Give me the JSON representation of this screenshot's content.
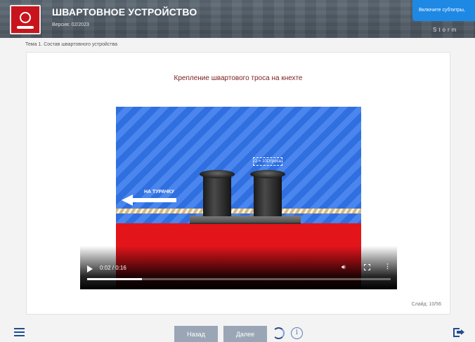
{
  "header": {
    "title": "ШВАРТОВНОЕ УСТРОЙСТВО",
    "version": "Версия: 02/2023",
    "subtitles_button": "Включите субтитры,",
    "brand": "Storm"
  },
  "topic": "Тема 1. Состав швартовного устройства",
  "slide": {
    "heading": "Крепление швартового троса на кнехте",
    "counter": "Слайд: 10/56"
  },
  "video": {
    "arrow_label": "НА ТУРАЧКУ",
    "dimension_label": "D = 10Dтроса",
    "time": "0:02 / 0:16",
    "progress": 0.18
  },
  "nav": {
    "back_label": "Назад",
    "next_label": "Далее",
    "info_symbol": "i"
  },
  "icons": [
    "menu-icon",
    "refresh-icon",
    "info-icon",
    "exit-icon",
    "play-icon",
    "volume-icon",
    "fullscreen-icon",
    "more-icon"
  ],
  "colors": {
    "header_bg": "#4e5963",
    "accent": "#1e88e5",
    "heading": "#7a1d1d",
    "nav_button": "#9aa6b6",
    "sea": "#2f6fe0",
    "deck": "#e4141b"
  }
}
